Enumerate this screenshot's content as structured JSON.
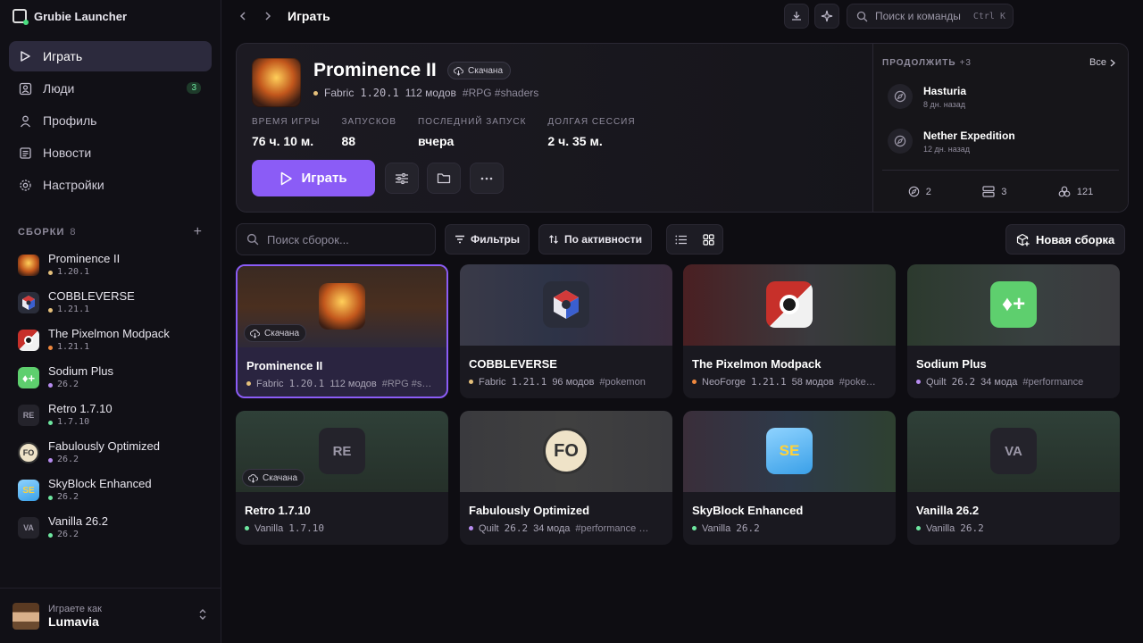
{
  "app": {
    "title": "Grubie Launcher"
  },
  "nav": [
    {
      "label": "Играть",
      "icon": "play-icon",
      "active": true
    },
    {
      "label": "Люди",
      "icon": "people-icon",
      "badge": "3"
    },
    {
      "label": "Профиль",
      "icon": "profile-icon"
    },
    {
      "label": "Новости",
      "icon": "news-icon"
    },
    {
      "label": "Настройки",
      "icon": "settings-icon"
    }
  ],
  "sidebar": {
    "packs_header": "СБОРКИ",
    "packs_count": "8"
  },
  "packs": [
    {
      "name": "Prominence II",
      "version": "1.20.1",
      "dot": "#e5c07b"
    },
    {
      "name": "COBBLEVERSE",
      "version": "1.21.1",
      "dot": "#e5c07b"
    },
    {
      "name": "The Pixelmon Modpack",
      "version": "1.21.1",
      "dot": "#f0883e"
    },
    {
      "name": "Sodium Plus",
      "version": "26.2",
      "dot": "#b78cf0"
    },
    {
      "name": "Retro 1.7.10",
      "version": "1.7.10",
      "dot": "#6ee7a0",
      "abbr": "RE"
    },
    {
      "name": "Fabulously Optimized",
      "version": "26.2",
      "dot": "#b78cf0",
      "abbr": "FO"
    },
    {
      "name": "SkyBlock Enhanced",
      "version": "26.2",
      "dot": "#6ee7a0",
      "abbr": "SE"
    },
    {
      "name": "Vanilla 26.2",
      "version": "26.2",
      "dot": "#6ee7a0",
      "abbr": "VA"
    }
  ],
  "user": {
    "label": "Играете как",
    "name": "Lumavia"
  },
  "topbar": {
    "crumb": "Играть",
    "search_placeholder": "Поиск и команды",
    "shortcut": "Ctrl K"
  },
  "hero": {
    "title": "Prominence II",
    "badge": "Скачана",
    "loader": "Fabric",
    "version": "1.20.1",
    "mods": "112 модов",
    "tags": "#RPG #shaders",
    "stats": [
      {
        "label": "ВРЕМЯ ИГРЫ",
        "value": "76 ч. 10 м."
      },
      {
        "label": "ЗАПУСКОВ",
        "value": "88"
      },
      {
        "label": "ПОСЛЕДНИЙ ЗАПУСК",
        "value": "вчера"
      },
      {
        "label": "ДОЛГАЯ СЕССИЯ",
        "value": "2 ч. 35 м."
      }
    ],
    "play_label": "Играть"
  },
  "continue": {
    "header": "ПРОДОЛЖИТЬ",
    "extra": "+3",
    "all_label": "Все",
    "items": [
      {
        "name": "Hasturia",
        "time": "8 дн. назад"
      },
      {
        "name": "Nether Expedition",
        "time": "12 дн. назад"
      }
    ],
    "footer": {
      "worlds": "2",
      "servers": "3",
      "mods": "121"
    }
  },
  "filters": {
    "search_placeholder": "Поиск сборок...",
    "filters_label": "Фильтры",
    "sort_label": "По активности",
    "new_pack_label": "Новая сборка"
  },
  "cards": [
    {
      "title": "Prominence II",
      "loader": "Fabric",
      "version": "1.20.1",
      "mods": "112 модов",
      "tags": "#RPG #s…",
      "dot": "#e5c07b",
      "badge": "Скачана"
    },
    {
      "title": "COBBLEVERSE",
      "loader": "Fabric",
      "version": "1.21.1",
      "mods": "96 модов",
      "tags": "#pokemon",
      "dot": "#e5c07b"
    },
    {
      "title": "The Pixelmon Modpack",
      "loader": "NeoForge",
      "version": "1.21.1",
      "mods": "58 модов",
      "tags": "#poke…",
      "dot": "#f0883e"
    },
    {
      "title": "Sodium Plus",
      "loader": "Quilt",
      "version": "26.2",
      "mods": "34 мода",
      "tags": "#performance",
      "dot": "#b78cf0"
    },
    {
      "title": "Retro 1.7.10",
      "loader": "Vanilla",
      "version": "1.7.10",
      "mods": "",
      "tags": "",
      "dot": "#6ee7a0",
      "badge": "Скачана",
      "abbr": "RE"
    },
    {
      "title": "Fabulously Optimized",
      "loader": "Quilt",
      "version": "26.2",
      "mods": "34 мода",
      "tags": "#performance …",
      "dot": "#b78cf0",
      "abbr": "FO"
    },
    {
      "title": "SkyBlock Enhanced",
      "loader": "Vanilla",
      "version": "26.2",
      "mods": "",
      "tags": "",
      "dot": "#6ee7a0",
      "abbr": "SE"
    },
    {
      "title": "Vanilla 26.2",
      "loader": "Vanilla",
      "version": "26.2",
      "mods": "",
      "tags": "",
      "dot": "#6ee7a0",
      "abbr": "VA"
    }
  ],
  "colors": {
    "accent": "#8b5cf6",
    "bg": "#0e0d12",
    "online": "#4ade80"
  }
}
